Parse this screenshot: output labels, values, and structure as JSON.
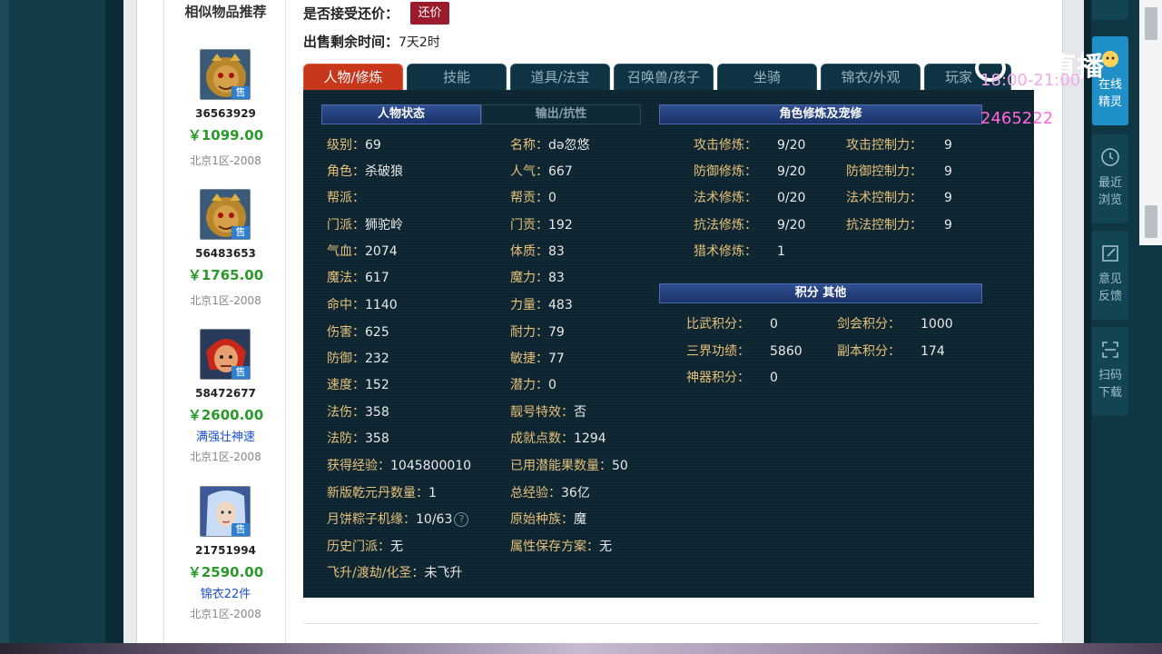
{
  "similar": {
    "title": "相似物品推荐",
    "sale_badge": "售",
    "items": [
      {
        "id": "36563929",
        "price": "￥1099.00",
        "note": "",
        "server": "北京1区-2008"
      },
      {
        "id": "56483653",
        "price": "￥1765.00",
        "note": "",
        "server": "北京1区-2008"
      },
      {
        "id": "58472677",
        "price": "￥2600.00",
        "note": "满强壮神速",
        "server": "北京1区-2008"
      },
      {
        "id": "21751994",
        "price": "￥2590.00",
        "note": "锦衣22件",
        "server": "北京1区-2008"
      }
    ]
  },
  "header": {
    "accept_counter_label": "是否接受还价：",
    "counter_button": "还价",
    "remaining_label": "出售剩余时间：",
    "remaining_value": "7天2时"
  },
  "tabs": [
    "人物/修炼",
    "技能",
    "道具/法宝",
    "召唤兽/孩子",
    "坐骑",
    "锦衣/外观",
    "玩家"
  ],
  "status": {
    "head_active": "人物状态",
    "head_inactive": "输出/抗性",
    "left": [
      {
        "label": "级别：",
        "value": "69"
      },
      {
        "label": "角色：",
        "value": "杀破狼"
      },
      {
        "label": "帮派：",
        "value": ""
      },
      {
        "label": "门派：",
        "value": "狮驼岭"
      },
      {
        "label": "气血：",
        "value": "2074"
      },
      {
        "label": "魔法：",
        "value": "617"
      },
      {
        "label": "命中：",
        "value": "1140"
      },
      {
        "label": "伤害：",
        "value": "625"
      },
      {
        "label": "防御：",
        "value": "232"
      },
      {
        "label": "速度：",
        "value": "152"
      },
      {
        "label": "法伤：",
        "value": "358"
      },
      {
        "label": "法防：",
        "value": "358"
      },
      {
        "label": "获得经验：",
        "value": "1045800010"
      },
      {
        "label": "新版乾元丹数量：",
        "value": "1"
      },
      {
        "label": "月饼粽子机缘：",
        "value": "10/63"
      },
      {
        "label": "历史门派：",
        "value": "无"
      },
      {
        "label": "飞升/渡劫/化圣：",
        "value": "未飞升"
      }
    ],
    "right": [
      {
        "label": "名称：",
        "value": "də忽悠"
      },
      {
        "label": "人气：",
        "value": "667"
      },
      {
        "label": "帮贡：",
        "value": "0"
      },
      {
        "label": "门贡：",
        "value": "192"
      },
      {
        "label": "体质：",
        "value": "83"
      },
      {
        "label": "魔力：",
        "value": "83"
      },
      {
        "label": "力量：",
        "value": "483"
      },
      {
        "label": "耐力：",
        "value": "79"
      },
      {
        "label": "敏捷：",
        "value": "77"
      },
      {
        "label": "潜力：",
        "value": "0"
      },
      {
        "label": "靓号特效：",
        "value": "否"
      },
      {
        "label": "成就点数：",
        "value": "1294"
      },
      {
        "label": "已用潜能果数量：",
        "value": "50"
      },
      {
        "label": "总经验：",
        "value": "36亿"
      },
      {
        "label": "原始种族：",
        "value": "魔"
      },
      {
        "label": "属性保存方案：",
        "value": "无"
      }
    ],
    "help_icon": "?"
  },
  "cultivation": {
    "head": "角色修炼及宠修",
    "left": [
      {
        "label": "攻击修炼：",
        "value": "9/20"
      },
      {
        "label": "防御修炼：",
        "value": "9/20"
      },
      {
        "label": "法术修炼：",
        "value": "0/20"
      },
      {
        "label": "抗法修炼：",
        "value": "9/20"
      },
      {
        "label": "猎术修炼：",
        "value": "1"
      }
    ],
    "right": [
      {
        "label": "攻击控制力：",
        "value": "9"
      },
      {
        "label": "防御控制力：",
        "value": "9"
      },
      {
        "label": "法术控制力：",
        "value": "9"
      },
      {
        "label": "抗法控制力：",
        "value": "9"
      }
    ]
  },
  "points": {
    "head": "积分 其他",
    "left": [
      {
        "label": "比武积分：",
        "value": "0"
      },
      {
        "label": "三界功绩：",
        "value": "5860"
      },
      {
        "label": "神器积分：",
        "value": "0"
      }
    ],
    "right": [
      {
        "label": "剑会积分：",
        "value": "1000"
      },
      {
        "label": "副本积分：",
        "value": "174"
      }
    ]
  },
  "watermark": {
    "logo": "CC直播",
    "time": "18:00-21:00",
    "room": "2465222"
  },
  "right_panel": [
    {
      "label_1": "在线",
      "label_2": "精灵",
      "icon": "spirit-icon"
    },
    {
      "label_1": "最近",
      "label_2": "浏览",
      "icon": "clock-icon"
    },
    {
      "label_1": "意见",
      "label_2": "反馈",
      "icon": "edit-icon"
    },
    {
      "label_1": "扫码",
      "label_2": "下载",
      "icon": "scan-icon"
    }
  ]
}
